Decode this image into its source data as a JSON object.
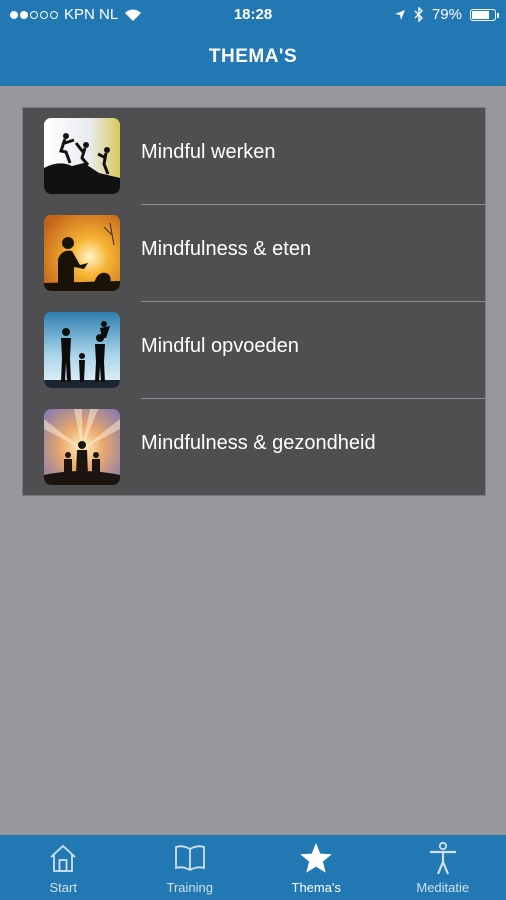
{
  "status_bar": {
    "carrier": "KPN NL",
    "time": "18:28",
    "battery": "79%",
    "battery_level": 0.79,
    "signal_bars": 2
  },
  "header": {
    "title": "THEMA'S"
  },
  "themes": {
    "items": [
      {
        "label": "Mindful werken",
        "image": "climbers-silhouette-image"
      },
      {
        "label": "Mindfulness & eten",
        "image": "sunset-eating-image"
      },
      {
        "label": "Mindful opvoeden",
        "image": "family-silhouette-image"
      },
      {
        "label": "Mindfulness & gezondheid",
        "image": "sunrays-group-image"
      }
    ]
  },
  "tabbar": {
    "tabs": [
      {
        "label": "Start",
        "icon": "home-icon",
        "active": false
      },
      {
        "label": "Training",
        "icon": "book-icon",
        "active": false
      },
      {
        "label": "Thema's",
        "icon": "star-icon",
        "active": true
      },
      {
        "label": "Meditatie",
        "icon": "person-icon",
        "active": false
      }
    ]
  },
  "colors": {
    "header_blue": "#2278b3",
    "page_background": "#98979c",
    "list_background": "#4f4e50"
  }
}
